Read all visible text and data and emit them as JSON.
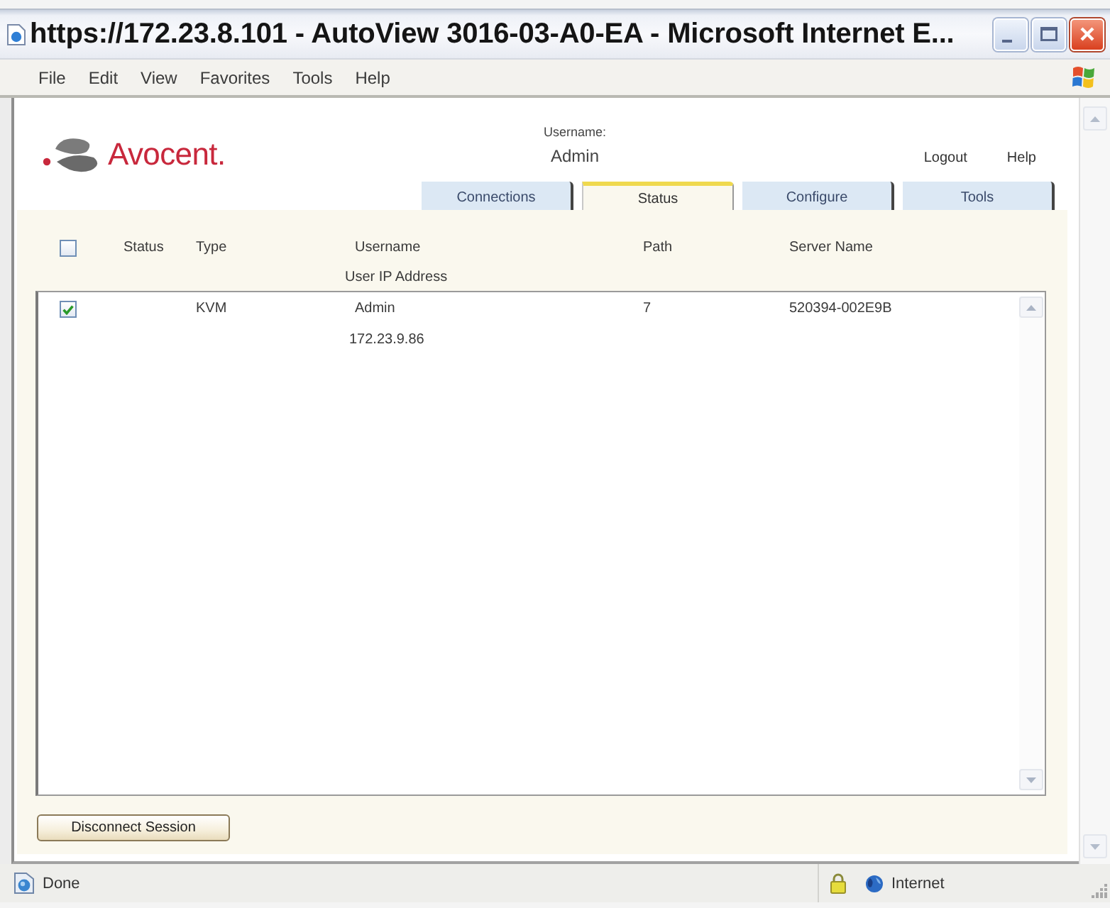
{
  "window": {
    "title": "https://172.23.8.101 - AutoView 3016-03-A0-EA - Microsoft Internet E..."
  },
  "menu_bar": {
    "items": [
      "File",
      "Edit",
      "View",
      "Favorites",
      "Tools",
      "Help"
    ]
  },
  "header": {
    "logo": "Avocent.",
    "username_label": "Username:",
    "username": "Admin",
    "links": [
      "Logout",
      "Help"
    ]
  },
  "tabs": [
    {
      "label": "Connections",
      "selected": false
    },
    {
      "label": "Status",
      "selected": true
    },
    {
      "label": "Configure",
      "selected": false
    },
    {
      "label": "Tools",
      "selected": false
    }
  ],
  "table": {
    "select_all": {
      "checked": false
    },
    "columns": [
      {
        "label": "Status"
      },
      {
        "label": "Type"
      },
      {
        "label": "Username",
        "sub_label": "User IP Address"
      },
      {
        "label": "Path"
      },
      {
        "label": "Server Name"
      }
    ],
    "rows": [
      {
        "checked": true,
        "type": "KVM",
        "username": "Admin",
        "user_ip_address": "172.23.9.86",
        "path": "7",
        "server_name": "520394-002E9B"
      }
    ]
  },
  "buttons": [
    {
      "label": "Disconnect Session"
    }
  ],
  "status_bar": {
    "text": "Done",
    "zone": "Internet"
  }
}
